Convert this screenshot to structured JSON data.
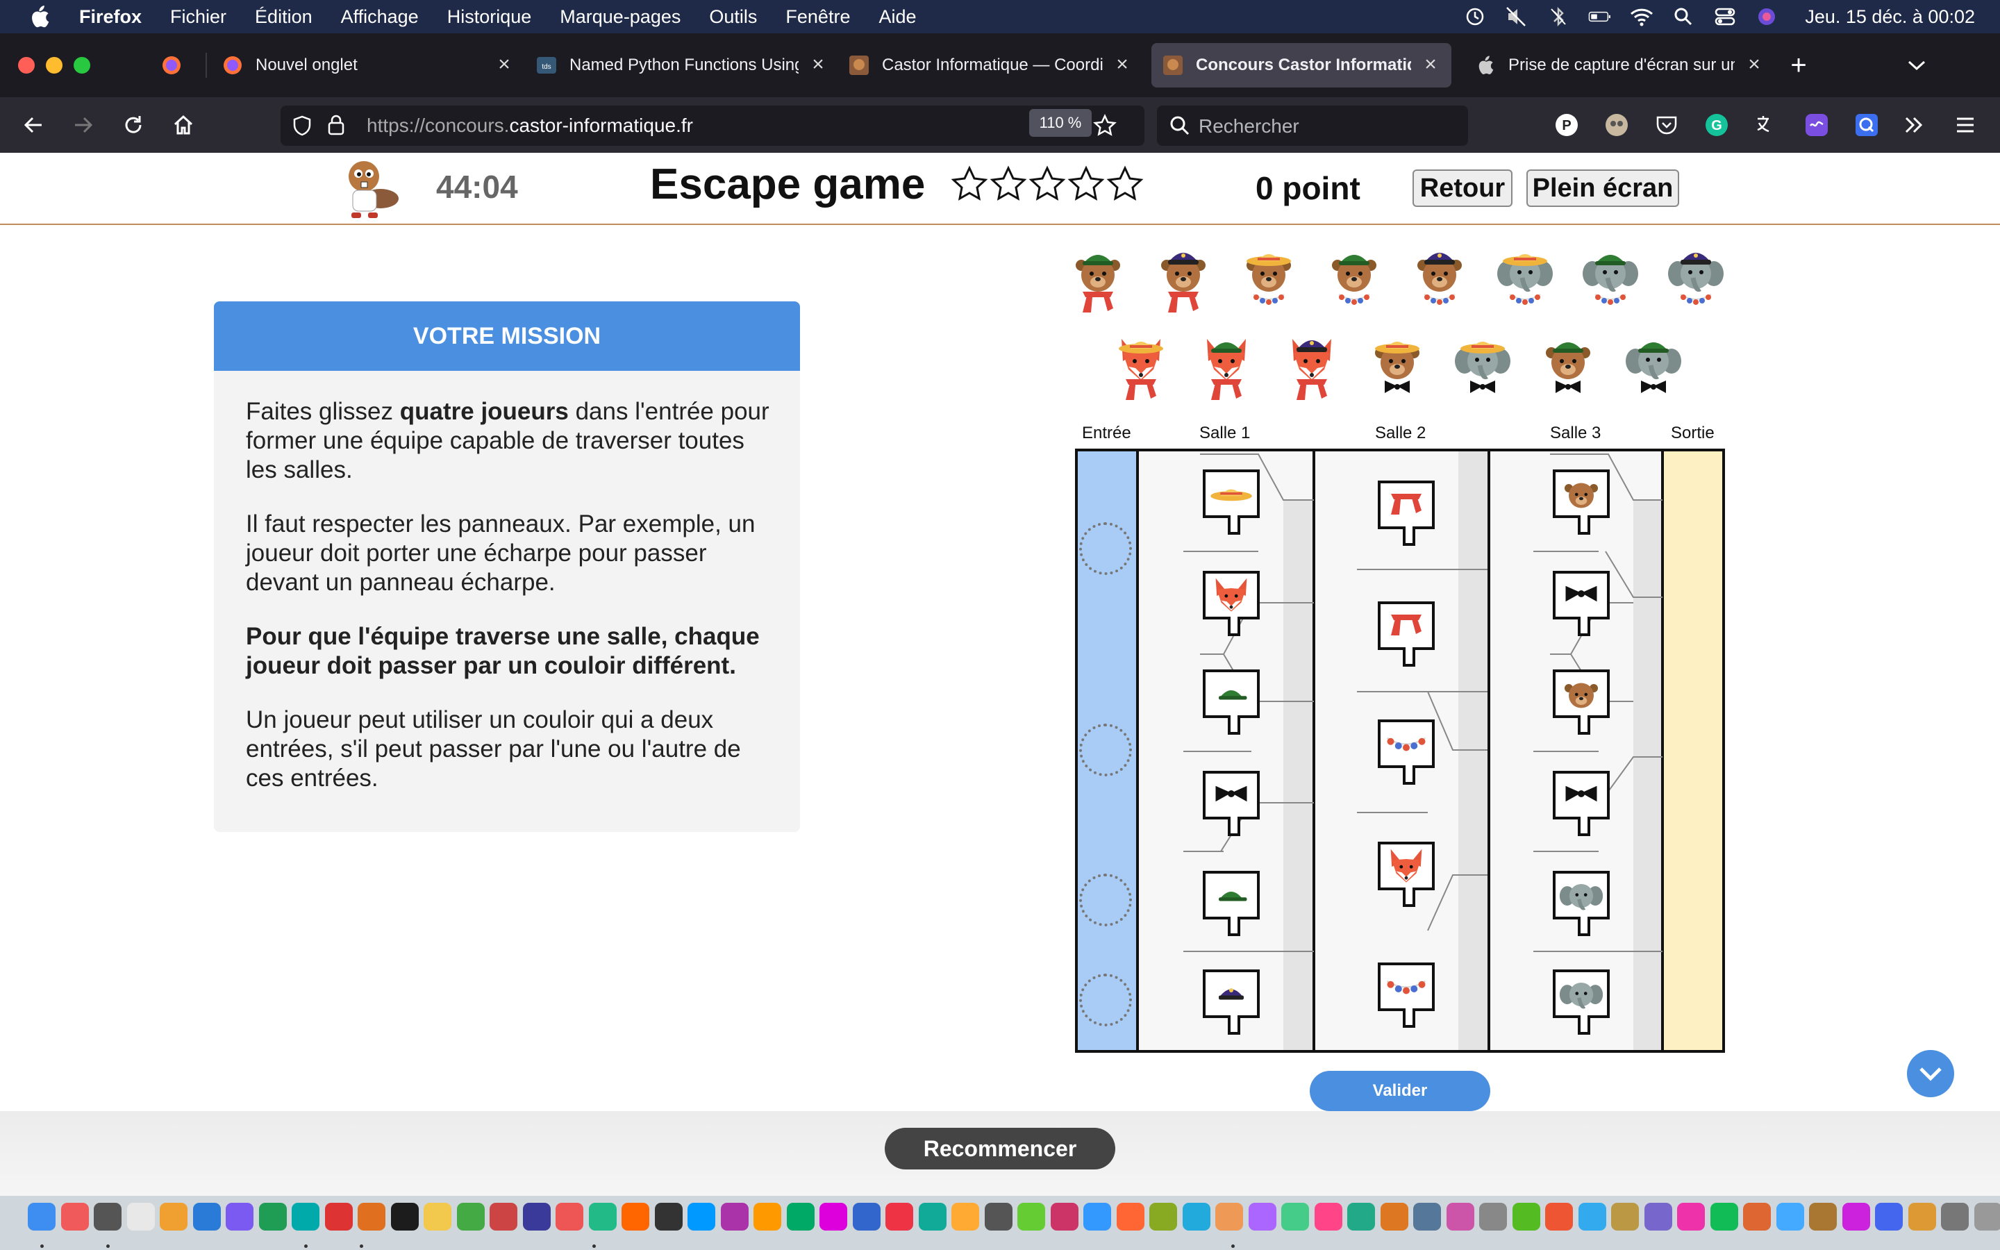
{
  "menubar": {
    "app": "Firefox",
    "items": [
      "Fichier",
      "Édition",
      "Affichage",
      "Historique",
      "Marque-pages",
      "Outils",
      "Fenêtre",
      "Aide"
    ],
    "clock": "Jeu. 15 déc. à  00:02"
  },
  "tabs": [
    {
      "title": "Nouvel onglet",
      "icon": "firefox-icon"
    },
    {
      "title": "Named Python Functions Using",
      "icon": "tds-icon"
    },
    {
      "title": "Castor Informatique — Coordina",
      "icon": "castor-icon"
    },
    {
      "title": "Concours Castor Informatique -",
      "icon": "castor-icon",
      "active": true
    },
    {
      "title": "Prise de capture d'écran sur un",
      "icon": "apple-icon"
    }
  ],
  "navbar": {
    "url_prefix": "https://concours.",
    "url_domain": "castor-informatique.fr",
    "zoom": "110 %",
    "search_placeholder": "Rechercher"
  },
  "header": {
    "timer": "44:04",
    "title": "Escape game",
    "stars_filled": 0,
    "stars_total": 5,
    "score": "0 point",
    "back_label": "Retour",
    "fullscreen_label": "Plein écran"
  },
  "mission": {
    "heading": "VOTRE MISSION",
    "p1_a": "Faites glissez ",
    "p1_b": "quatre joueurs",
    "p1_c": " dans l'entrée pour former une équipe capable de traverser toutes les salles.",
    "p2": "Il faut respecter les panneaux. Par exemple, un joueur doit porter une écharpe pour passer devant un panneau écharpe.",
    "p3": "Pour que l'équipe traverse une salle, chaque joueur doit passer par un couloir différent.",
    "p4": "Un joueur peut utiliser un couloir qui a deux entrées, s'il peut passer par l'une ou l'autre de ces entrées."
  },
  "board": {
    "columns": [
      "Entrée",
      "Salle 1",
      "Salle 2",
      "Salle 3",
      "Sortie"
    ],
    "entry_slots": 4,
    "salle1_signs": [
      "straw-hat",
      "fox",
      "green-cap",
      "bow-tie",
      "green-cap",
      "police-cap"
    ],
    "salle2_signs": [
      "scarf",
      "scarf",
      "bead-necklace",
      "fox",
      "bead-necklace"
    ],
    "salle3_signs": [
      "bear",
      "bow-tie",
      "bear",
      "bow-tie",
      "elephant",
      "elephant"
    ]
  },
  "players_row1": [
    {
      "animal": "bear",
      "hat": "green-cap",
      "neck": "scarf"
    },
    {
      "animal": "bear",
      "hat": "police-cap",
      "neck": "scarf"
    },
    {
      "animal": "bear",
      "hat": "straw-hat",
      "neck": "bead-necklace"
    },
    {
      "animal": "bear",
      "hat": "green-cap",
      "neck": "bead-necklace"
    },
    {
      "animal": "bear",
      "hat": "police-cap",
      "neck": "bead-necklace"
    },
    {
      "animal": "elephant",
      "hat": "straw-hat",
      "neck": "bead-necklace"
    },
    {
      "animal": "elephant",
      "hat": "green-cap",
      "neck": "bead-necklace"
    },
    {
      "animal": "elephant",
      "hat": "police-cap",
      "neck": "bead-necklace"
    }
  ],
  "players_row2": [
    {
      "animal": "fox",
      "hat": "straw-hat",
      "neck": "scarf"
    },
    {
      "animal": "fox",
      "hat": "green-cap",
      "neck": "scarf"
    },
    {
      "animal": "fox",
      "hat": "police-cap",
      "neck": "scarf"
    },
    {
      "animal": "bear",
      "hat": "straw-hat",
      "neck": "bow-tie"
    },
    {
      "animal": "elephant",
      "hat": "straw-hat",
      "neck": "bow-tie"
    },
    {
      "animal": "bear",
      "hat": "green-cap",
      "neck": "bow-tie"
    },
    {
      "animal": "elephant",
      "hat": "green-cap",
      "neck": "bow-tie"
    }
  ],
  "validate_label": "Valider",
  "restart_label": "Recommencer",
  "colors": {
    "accent": "#4a8fe0",
    "entry": "#a8ccf5",
    "exit": "#fdf0c2",
    "corridor_wall": "#e4e4e4"
  }
}
